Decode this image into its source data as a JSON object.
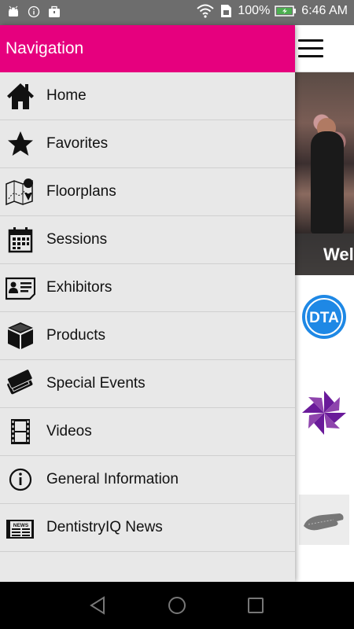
{
  "status_bar": {
    "battery": "100%",
    "time": "6:46 AM",
    "icons": [
      "android-icon",
      "info-icon",
      "briefcase-icon",
      "wifi-icon",
      "sim-icon",
      "battery-icon"
    ]
  },
  "drawer": {
    "title": "Navigation",
    "header_color": "#e6007e",
    "items": [
      {
        "label": "Home",
        "icon": "home-icon"
      },
      {
        "label": "Favorites",
        "icon": "star-icon"
      },
      {
        "label": "Floorplans",
        "icon": "map-icon"
      },
      {
        "label": "Sessions",
        "icon": "calendar-icon"
      },
      {
        "label": "Exhibitors",
        "icon": "id-card-icon"
      },
      {
        "label": "Products",
        "icon": "box-icon"
      },
      {
        "label": "Special Events",
        "icon": "tickets-icon"
      },
      {
        "label": "Videos",
        "icon": "film-icon"
      },
      {
        "label": "General Information",
        "icon": "info-circle-icon"
      },
      {
        "label": "DentistryIQ News",
        "icon": "newspaper-icon"
      }
    ]
  },
  "background_app": {
    "hero_caption": "Wel",
    "logos": [
      "dta-logo",
      "pinwheel-logo",
      "glove-image"
    ]
  },
  "android_nav": {
    "buttons": [
      "back-icon",
      "home-circle-icon",
      "recents-icon"
    ]
  }
}
